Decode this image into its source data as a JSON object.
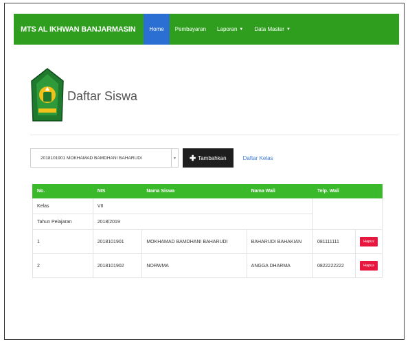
{
  "navbar": {
    "brand": "MTS AL IKHWAN BANJARMASIN",
    "items": [
      {
        "label": "Home"
      },
      {
        "label": "Pembayaran"
      },
      {
        "label": "Laporan"
      },
      {
        "label": "Data Master"
      }
    ]
  },
  "page": {
    "title": "Daftar Siswa"
  },
  "controls": {
    "select_value": "2018101901 MOKHAMAD BAMDHANI BAHARUDI",
    "add_button": "Tambahkan",
    "list_link": "Daftar Kelas"
  },
  "info": {
    "kelas_label": "Kelas",
    "kelas_value": "VII",
    "tahun_label": "Tahun Pelajaran",
    "tahun_value": "2018/2019"
  },
  "table": {
    "headers": [
      "No.",
      "NIS",
      "Nama Siswa",
      "Nama Wali",
      "Telp. Wali",
      ""
    ],
    "rows": [
      {
        "no": "1",
        "nis": "2018101901",
        "nama": "MOKHAMAD BAMDHANI BAHARUDI",
        "wali": "BAHARUDI BAHAKIAN",
        "telp": "081111111",
        "action": "Hapus"
      },
      {
        "no": "2",
        "nis": "2018101902",
        "nama": "NORWMA",
        "wali": "ANGGA DHARMA",
        "telp": "0822222222",
        "action": "Hapus"
      }
    ]
  },
  "colors": {
    "navbar": "#2f9e1f",
    "active_nav": "#2a6fd1",
    "table_header": "#3ab92b",
    "delete_button": "#e8173f"
  }
}
